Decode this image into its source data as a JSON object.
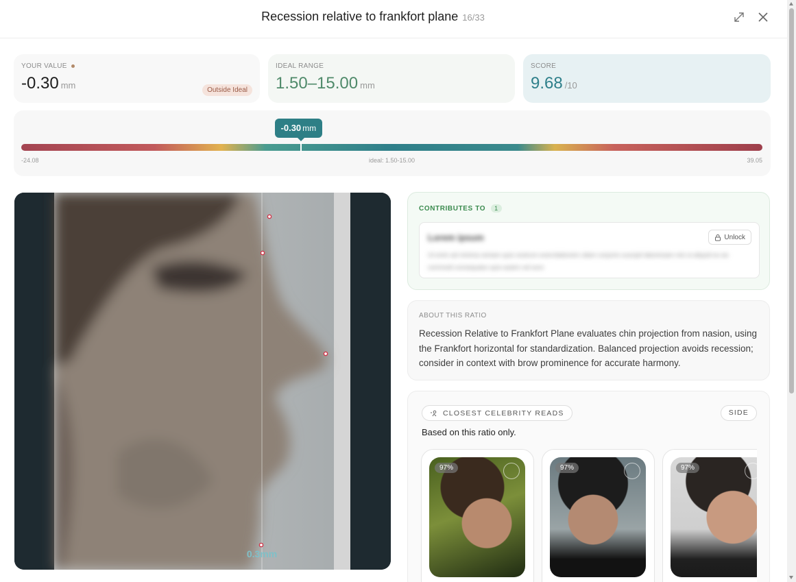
{
  "header": {
    "title": "Recession relative to frankfort plane",
    "counter": "16/33"
  },
  "stats": {
    "your_value": {
      "label": "YOUR VALUE",
      "value": "-0.30",
      "unit": "mm",
      "badge": "Outside Ideal"
    },
    "ideal_range": {
      "label": "IDEAL RANGE",
      "value": "1.50–15.00",
      "unit": "mm"
    },
    "score": {
      "label": "SCORE",
      "value": "9.68",
      "unit": "/10"
    }
  },
  "range": {
    "marker_value": "-0.30",
    "marker_unit": "mm",
    "min_label": "-24.08",
    "mid_label": "ideal: 1.50-15.00",
    "max_label": "39.05",
    "marker_fraction": 0.377
  },
  "photo": {
    "measurement_label": "0.3mm"
  },
  "contributes": {
    "heading": "CONTRIBUTES TO",
    "count": "1",
    "locked_title": "Lorem ipsum",
    "locked_text": "Ut enim ad minima veniam quis nostrum exercitationem ullam corporis suscipit laboriosam nisi ut aliquid ex ea commodi consequatur quis autem vel eum",
    "unlock_label": "Unlock"
  },
  "about": {
    "heading": "ABOUT THIS RATIO",
    "text": "Recession Relative to Frankfort Plane evaluates chin projection from nasion, using the Frankfort horizontal for standardization. Balanced projection avoids recession; consider in context with brow prominence for accurate harmony."
  },
  "celebrities": {
    "chip_label": "CLOSEST CELEBRITY READS",
    "side_label": "SIDE",
    "subtitle": "Based on this ratio only.",
    "cards": [
      {
        "match": "97%"
      },
      {
        "match": "97%"
      },
      {
        "match": "97%"
      }
    ]
  }
}
